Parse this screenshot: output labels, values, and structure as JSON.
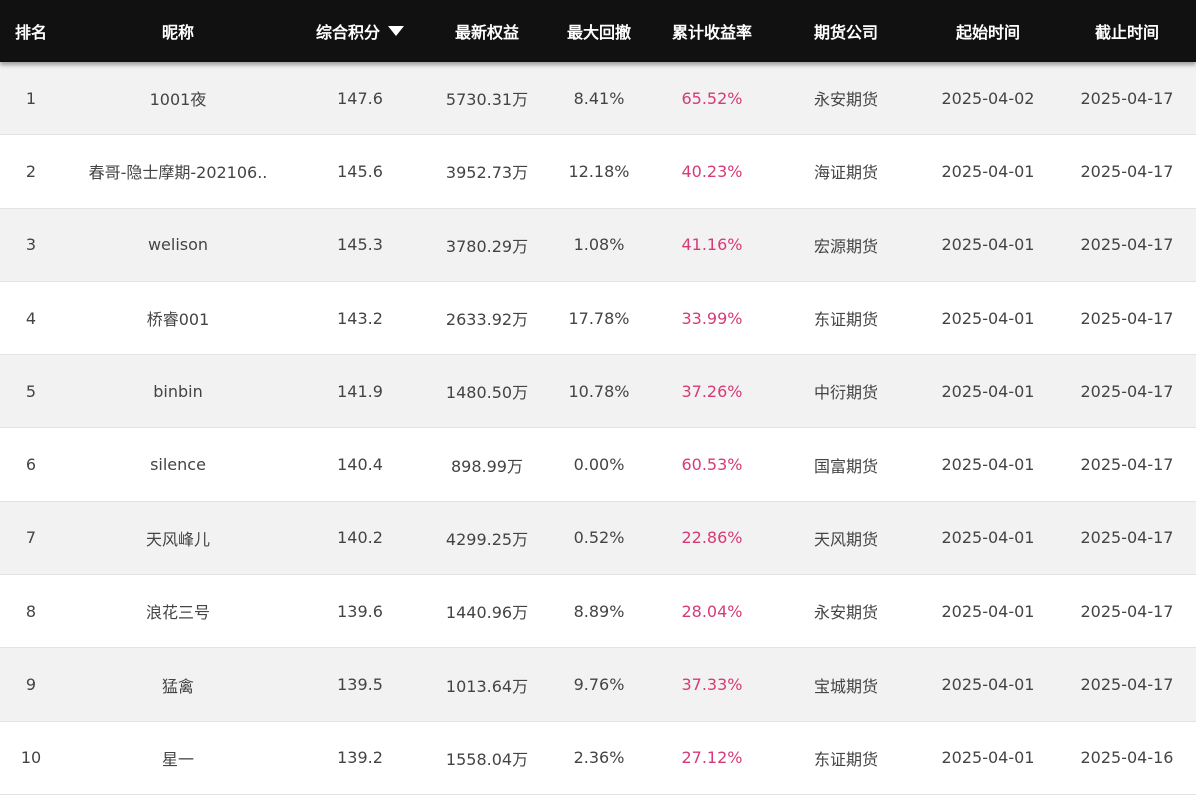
{
  "colors": {
    "header_bg": "#111111",
    "row_alt_bg": "#f2f2f2",
    "rate_text": "#d63a78",
    "body_text": "#444444"
  },
  "header": {
    "rank": "排名",
    "nickname": "昵称",
    "score": "综合积分",
    "equity": "最新权益",
    "max_drawdown": "最大回撤",
    "cumulative_return": "累计收益率",
    "broker": "期货公司",
    "start_date": "起始时间",
    "end_date": "截止时间",
    "sort_icon": "triangle-down-icon"
  },
  "rows": [
    {
      "rank": "1",
      "nickname": "1001夜",
      "score": "147.6",
      "equity": "5730.31万",
      "max_drawdown": "8.41%",
      "cumulative_return": "65.52%",
      "broker": "永安期货",
      "start_date": "2025-04-02",
      "end_date": "2025-04-17"
    },
    {
      "rank": "2",
      "nickname": "春哥-隐士摩期-202106..",
      "score": "145.6",
      "equity": "3952.73万",
      "max_drawdown": "12.18%",
      "cumulative_return": "40.23%",
      "broker": "海证期货",
      "start_date": "2025-04-01",
      "end_date": "2025-04-17"
    },
    {
      "rank": "3",
      "nickname": "welison",
      "score": "145.3",
      "equity": "3780.29万",
      "max_drawdown": "1.08%",
      "cumulative_return": "41.16%",
      "broker": "宏源期货",
      "start_date": "2025-04-01",
      "end_date": "2025-04-17"
    },
    {
      "rank": "4",
      "nickname": "桥睿001",
      "score": "143.2",
      "equity": "2633.92万",
      "max_drawdown": "17.78%",
      "cumulative_return": "33.99%",
      "broker": "东证期货",
      "start_date": "2025-04-01",
      "end_date": "2025-04-17"
    },
    {
      "rank": "5",
      "nickname": "binbin",
      "score": "141.9",
      "equity": "1480.50万",
      "max_drawdown": "10.78%",
      "cumulative_return": "37.26%",
      "broker": "中衍期货",
      "start_date": "2025-04-01",
      "end_date": "2025-04-17"
    },
    {
      "rank": "6",
      "nickname": "silence",
      "score": "140.4",
      "equity": "898.99万",
      "max_drawdown": "0.00%",
      "cumulative_return": "60.53%",
      "broker": "国富期货",
      "start_date": "2025-04-01",
      "end_date": "2025-04-17"
    },
    {
      "rank": "7",
      "nickname": "天风峰儿",
      "score": "140.2",
      "equity": "4299.25万",
      "max_drawdown": "0.52%",
      "cumulative_return": "22.86%",
      "broker": "天风期货",
      "start_date": "2025-04-01",
      "end_date": "2025-04-17"
    },
    {
      "rank": "8",
      "nickname": "浪花三号",
      "score": "139.6",
      "equity": "1440.96万",
      "max_drawdown": "8.89%",
      "cumulative_return": "28.04%",
      "broker": "永安期货",
      "start_date": "2025-04-01",
      "end_date": "2025-04-17"
    },
    {
      "rank": "9",
      "nickname": "猛禽",
      "score": "139.5",
      "equity": "1013.64万",
      "max_drawdown": "9.76%",
      "cumulative_return": "37.33%",
      "broker": "宝城期货",
      "start_date": "2025-04-01",
      "end_date": "2025-04-17"
    },
    {
      "rank": "10",
      "nickname": "星一",
      "score": "139.2",
      "equity": "1558.04万",
      "max_drawdown": "2.36%",
      "cumulative_return": "27.12%",
      "broker": "东证期货",
      "start_date": "2025-04-01",
      "end_date": "2025-04-16"
    }
  ]
}
